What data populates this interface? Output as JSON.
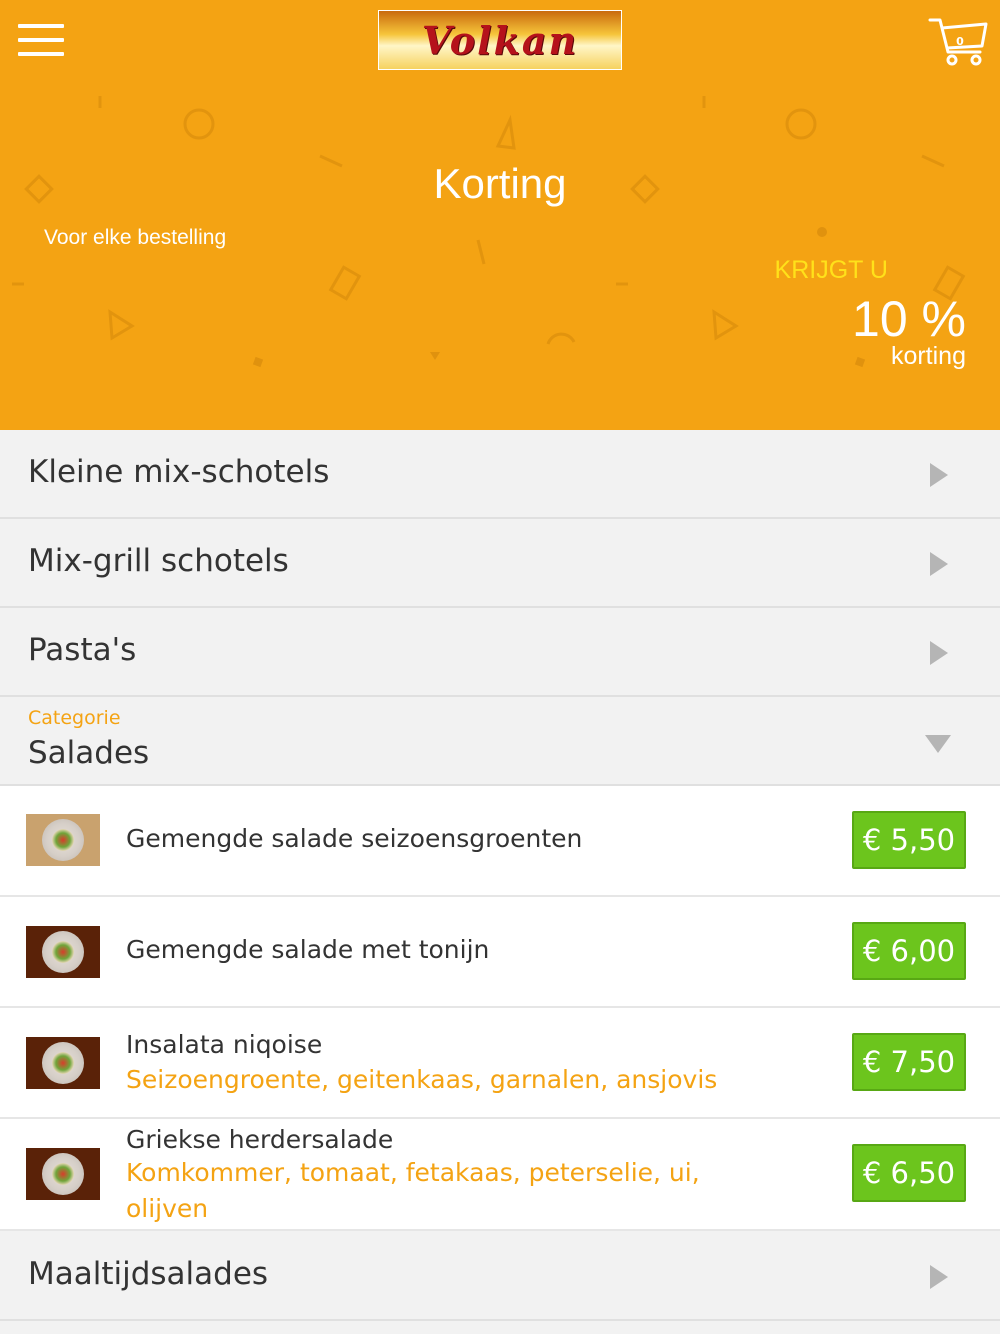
{
  "header": {
    "logo_text": "Volkan",
    "cart_count": "0"
  },
  "banner": {
    "title": "Korting",
    "subtitle": "Voor elke bestelling",
    "get_label": "KRIJGT U",
    "percent": "10 %",
    "discount_label": "korting"
  },
  "categories": {
    "kleine": "Kleine mix-schotels",
    "mixgrill": "Mix-grill schotels",
    "pasta": "Pasta's",
    "salades_caption": "Categorie",
    "salades": "Salades",
    "maaltijd": "Maaltijdsalades"
  },
  "items": [
    {
      "name": "Gemengde salade seizoensgroenten",
      "desc": "",
      "price": "€ 5,50"
    },
    {
      "name": "Gemengde salade met tonijn",
      "desc": "",
      "price": "€ 6,00"
    },
    {
      "name": "Insalata niqoise",
      "desc": "Seizoengroente, geitenkaas, garnalen, ansjovis",
      "price": "€ 7,50"
    },
    {
      "name": "Griekse herdersalade",
      "desc": "Komkommer, tomaat, fetakaas, peterselie, ui, olijven",
      "price": "€ 6,50"
    }
  ],
  "colors": {
    "brand_orange": "#f4a313",
    "price_green": "#6cc51d",
    "highlight_yellow": "#ffe11a"
  },
  "icons": {
    "menu": "hamburger-icon",
    "cart": "cart-icon",
    "collapsed": "triangle-right-icon",
    "expanded": "triangle-down-icon"
  }
}
